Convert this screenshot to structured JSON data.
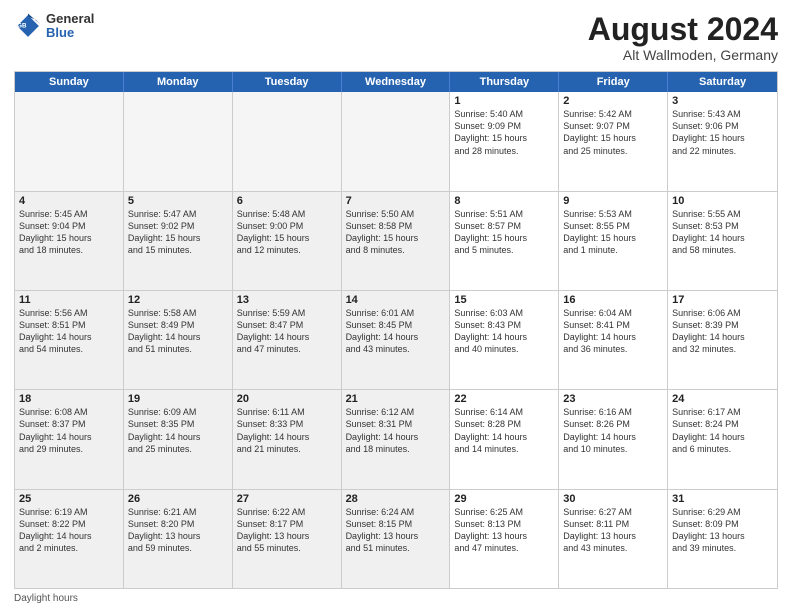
{
  "header": {
    "logo_general": "General",
    "logo_blue": "Blue",
    "title": "August 2024",
    "subtitle": "Alt Wallmoden, Germany"
  },
  "days_of_week": [
    "Sunday",
    "Monday",
    "Tuesday",
    "Wednesday",
    "Thursday",
    "Friday",
    "Saturday"
  ],
  "footer_label": "Daylight hours",
  "weeks": [
    [
      {
        "day": "",
        "text": "",
        "shaded": true,
        "empty": true
      },
      {
        "day": "",
        "text": "",
        "shaded": true,
        "empty": true
      },
      {
        "day": "",
        "text": "",
        "shaded": true,
        "empty": true
      },
      {
        "day": "",
        "text": "",
        "shaded": true,
        "empty": true
      },
      {
        "day": "1",
        "text": "Sunrise: 5:40 AM\nSunset: 9:09 PM\nDaylight: 15 hours\nand 28 minutes.",
        "shaded": false
      },
      {
        "day": "2",
        "text": "Sunrise: 5:42 AM\nSunset: 9:07 PM\nDaylight: 15 hours\nand 25 minutes.",
        "shaded": false
      },
      {
        "day": "3",
        "text": "Sunrise: 5:43 AM\nSunset: 9:06 PM\nDaylight: 15 hours\nand 22 minutes.",
        "shaded": false
      }
    ],
    [
      {
        "day": "4",
        "text": "Sunrise: 5:45 AM\nSunset: 9:04 PM\nDaylight: 15 hours\nand 18 minutes.",
        "shaded": true
      },
      {
        "day": "5",
        "text": "Sunrise: 5:47 AM\nSunset: 9:02 PM\nDaylight: 15 hours\nand 15 minutes.",
        "shaded": true
      },
      {
        "day": "6",
        "text": "Sunrise: 5:48 AM\nSunset: 9:00 PM\nDaylight: 15 hours\nand 12 minutes.",
        "shaded": true
      },
      {
        "day": "7",
        "text": "Sunrise: 5:50 AM\nSunset: 8:58 PM\nDaylight: 15 hours\nand 8 minutes.",
        "shaded": true
      },
      {
        "day": "8",
        "text": "Sunrise: 5:51 AM\nSunset: 8:57 PM\nDaylight: 15 hours\nand 5 minutes.",
        "shaded": false
      },
      {
        "day": "9",
        "text": "Sunrise: 5:53 AM\nSunset: 8:55 PM\nDaylight: 15 hours\nand 1 minute.",
        "shaded": false
      },
      {
        "day": "10",
        "text": "Sunrise: 5:55 AM\nSunset: 8:53 PM\nDaylight: 14 hours\nand 58 minutes.",
        "shaded": false
      }
    ],
    [
      {
        "day": "11",
        "text": "Sunrise: 5:56 AM\nSunset: 8:51 PM\nDaylight: 14 hours\nand 54 minutes.",
        "shaded": true
      },
      {
        "day": "12",
        "text": "Sunrise: 5:58 AM\nSunset: 8:49 PM\nDaylight: 14 hours\nand 51 minutes.",
        "shaded": true
      },
      {
        "day": "13",
        "text": "Sunrise: 5:59 AM\nSunset: 8:47 PM\nDaylight: 14 hours\nand 47 minutes.",
        "shaded": true
      },
      {
        "day": "14",
        "text": "Sunrise: 6:01 AM\nSunset: 8:45 PM\nDaylight: 14 hours\nand 43 minutes.",
        "shaded": true
      },
      {
        "day": "15",
        "text": "Sunrise: 6:03 AM\nSunset: 8:43 PM\nDaylight: 14 hours\nand 40 minutes.",
        "shaded": false
      },
      {
        "day": "16",
        "text": "Sunrise: 6:04 AM\nSunset: 8:41 PM\nDaylight: 14 hours\nand 36 minutes.",
        "shaded": false
      },
      {
        "day": "17",
        "text": "Sunrise: 6:06 AM\nSunset: 8:39 PM\nDaylight: 14 hours\nand 32 minutes.",
        "shaded": false
      }
    ],
    [
      {
        "day": "18",
        "text": "Sunrise: 6:08 AM\nSunset: 8:37 PM\nDaylight: 14 hours\nand 29 minutes.",
        "shaded": true
      },
      {
        "day": "19",
        "text": "Sunrise: 6:09 AM\nSunset: 8:35 PM\nDaylight: 14 hours\nand 25 minutes.",
        "shaded": true
      },
      {
        "day": "20",
        "text": "Sunrise: 6:11 AM\nSunset: 8:33 PM\nDaylight: 14 hours\nand 21 minutes.",
        "shaded": true
      },
      {
        "day": "21",
        "text": "Sunrise: 6:12 AM\nSunset: 8:31 PM\nDaylight: 14 hours\nand 18 minutes.",
        "shaded": true
      },
      {
        "day": "22",
        "text": "Sunrise: 6:14 AM\nSunset: 8:28 PM\nDaylight: 14 hours\nand 14 minutes.",
        "shaded": false
      },
      {
        "day": "23",
        "text": "Sunrise: 6:16 AM\nSunset: 8:26 PM\nDaylight: 14 hours\nand 10 minutes.",
        "shaded": false
      },
      {
        "day": "24",
        "text": "Sunrise: 6:17 AM\nSunset: 8:24 PM\nDaylight: 14 hours\nand 6 minutes.",
        "shaded": false
      }
    ],
    [
      {
        "day": "25",
        "text": "Sunrise: 6:19 AM\nSunset: 8:22 PM\nDaylight: 14 hours\nand 2 minutes.",
        "shaded": true
      },
      {
        "day": "26",
        "text": "Sunrise: 6:21 AM\nSunset: 8:20 PM\nDaylight: 13 hours\nand 59 minutes.",
        "shaded": true
      },
      {
        "day": "27",
        "text": "Sunrise: 6:22 AM\nSunset: 8:17 PM\nDaylight: 13 hours\nand 55 minutes.",
        "shaded": true
      },
      {
        "day": "28",
        "text": "Sunrise: 6:24 AM\nSunset: 8:15 PM\nDaylight: 13 hours\nand 51 minutes.",
        "shaded": true
      },
      {
        "day": "29",
        "text": "Sunrise: 6:25 AM\nSunset: 8:13 PM\nDaylight: 13 hours\nand 47 minutes.",
        "shaded": false
      },
      {
        "day": "30",
        "text": "Sunrise: 6:27 AM\nSunset: 8:11 PM\nDaylight: 13 hours\nand 43 minutes.",
        "shaded": false
      },
      {
        "day": "31",
        "text": "Sunrise: 6:29 AM\nSunset: 8:09 PM\nDaylight: 13 hours\nand 39 minutes.",
        "shaded": false
      }
    ]
  ]
}
